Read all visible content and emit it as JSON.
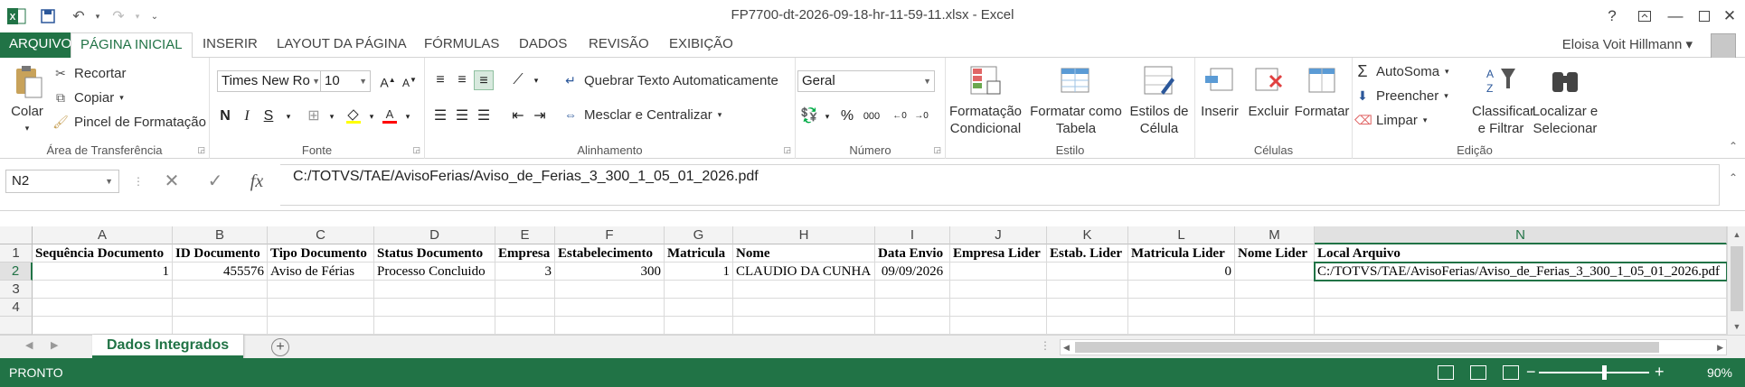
{
  "window": {
    "title": "FP7700-dt-2026-09-18-hr-11-59-11.xlsx - Excel",
    "help_label": "?",
    "user_name": "Eloisa Voit Hillmann"
  },
  "tabs": [
    "ARQUIVO",
    "PÁGINA INICIAL",
    "INSERIR",
    "LAYOUT DA PÁGINA",
    "FÓRMULAS",
    "DADOS",
    "REVISÃO",
    "EXIBIÇÃO"
  ],
  "ribbon": {
    "clipboard": {
      "label": "Área de Transferência",
      "paste": "Colar",
      "cut": "Recortar",
      "copy": "Copiar",
      "format_painter": "Pincel de Formatação"
    },
    "font": {
      "label": "Fonte",
      "font_name": "Times New Ro",
      "font_size": "10",
      "bold": "N",
      "italic": "I",
      "underline": "S"
    },
    "alignment": {
      "label": "Alinhamento",
      "wrap": "Quebrar Texto Automaticamente",
      "merge": "Mesclar e Centralizar"
    },
    "number": {
      "label": "Número",
      "format": "Geral",
      "percent": "%",
      "thousands": "000"
    },
    "styles": {
      "label": "Estilo",
      "conditional": "Formatação Condicional",
      "as_table": "Formatar como Tabela",
      "cell_styles": "Estilos de Célula"
    },
    "cells": {
      "label": "Células",
      "insert": "Inserir",
      "delete": "Excluir",
      "format": "Formatar"
    },
    "editing": {
      "label": "Edição",
      "autosum": "AutoSoma",
      "fill": "Preencher",
      "clear": "Limpar",
      "sort_filter": "Classificar e Filtrar",
      "find_select": "Localizar e Selecionar"
    }
  },
  "formula_bar": {
    "name_box": "N2",
    "fx": "fx",
    "value": "C:/TOTVS/TAE/AvisoFerias/Aviso_de_Ferias_3_300_1_05_01_2026.pdf"
  },
  "grid": {
    "columns": [
      "A",
      "B",
      "C",
      "D",
      "E",
      "F",
      "G",
      "H",
      "I",
      "J",
      "K",
      "L",
      "M",
      "N"
    ],
    "row_numbers": [
      "1",
      "2",
      "3",
      "4"
    ],
    "header_row": [
      "Sequência Documento",
      "ID Documento",
      "Tipo Documento",
      "Status Documento",
      "Empresa",
      "Estabelecimento",
      "Matricula",
      "Nome",
      "Data Envio",
      "Empresa Lider",
      "Estab. Lider",
      "Matricula Lider",
      "Nome Lider",
      "Local Arquivo"
    ],
    "data_row": [
      "1",
      "455576",
      "Aviso de Férias",
      "Processo Concluido",
      "3",
      "300",
      "1",
      "CLAUDIO DA CUNHA",
      "09/09/2026",
      "",
      "",
      "0",
      "",
      "C:/TOTVS/TAE/AvisoFerias/Aviso_de_Ferias_3_300_1_05_01_2026.pdf"
    ],
    "active_cell": "N2"
  },
  "sheets": {
    "active": "Dados Integrados"
  },
  "status": {
    "text": "PRONTO",
    "zoom": "90%"
  },
  "colors": {
    "accent": "#217346",
    "header_bg": "#f3f3f3"
  }
}
